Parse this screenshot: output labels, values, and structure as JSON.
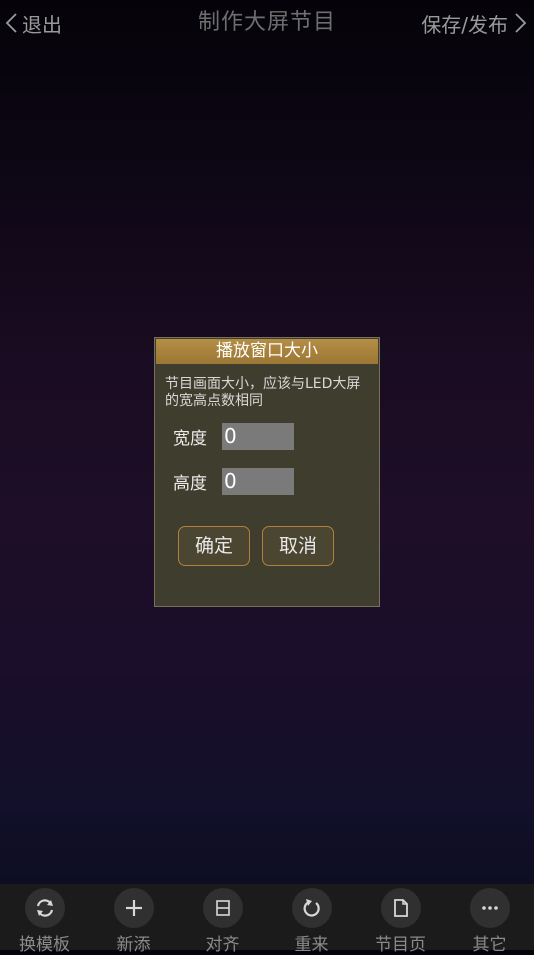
{
  "header": {
    "back_label": "退出",
    "title": "制作大屏节目",
    "publish_label": "保存/发布"
  },
  "dialog": {
    "title": "播放窗口大小",
    "message": "节目画面大小，应该与LED大屏的宽高点数相同",
    "width_label": "宽度",
    "width_value": "0",
    "height_label": "高度",
    "height_value": "0",
    "confirm_label": "确定",
    "cancel_label": "取消"
  },
  "toolbar": {
    "items": [
      {
        "label": "换模板",
        "icon": "swap-template-icon"
      },
      {
        "label": "新添",
        "icon": "plus-icon"
      },
      {
        "label": "对齐",
        "icon": "align-icon"
      },
      {
        "label": "重来",
        "icon": "redo-icon"
      },
      {
        "label": "节目页",
        "icon": "page-icon"
      },
      {
        "label": "其它",
        "icon": "more-icon"
      }
    ]
  },
  "colors": {
    "dialog_title_bg": "#b58e45",
    "dialog_bg": "#3f3e2e",
    "button_border": "#b1813c"
  }
}
